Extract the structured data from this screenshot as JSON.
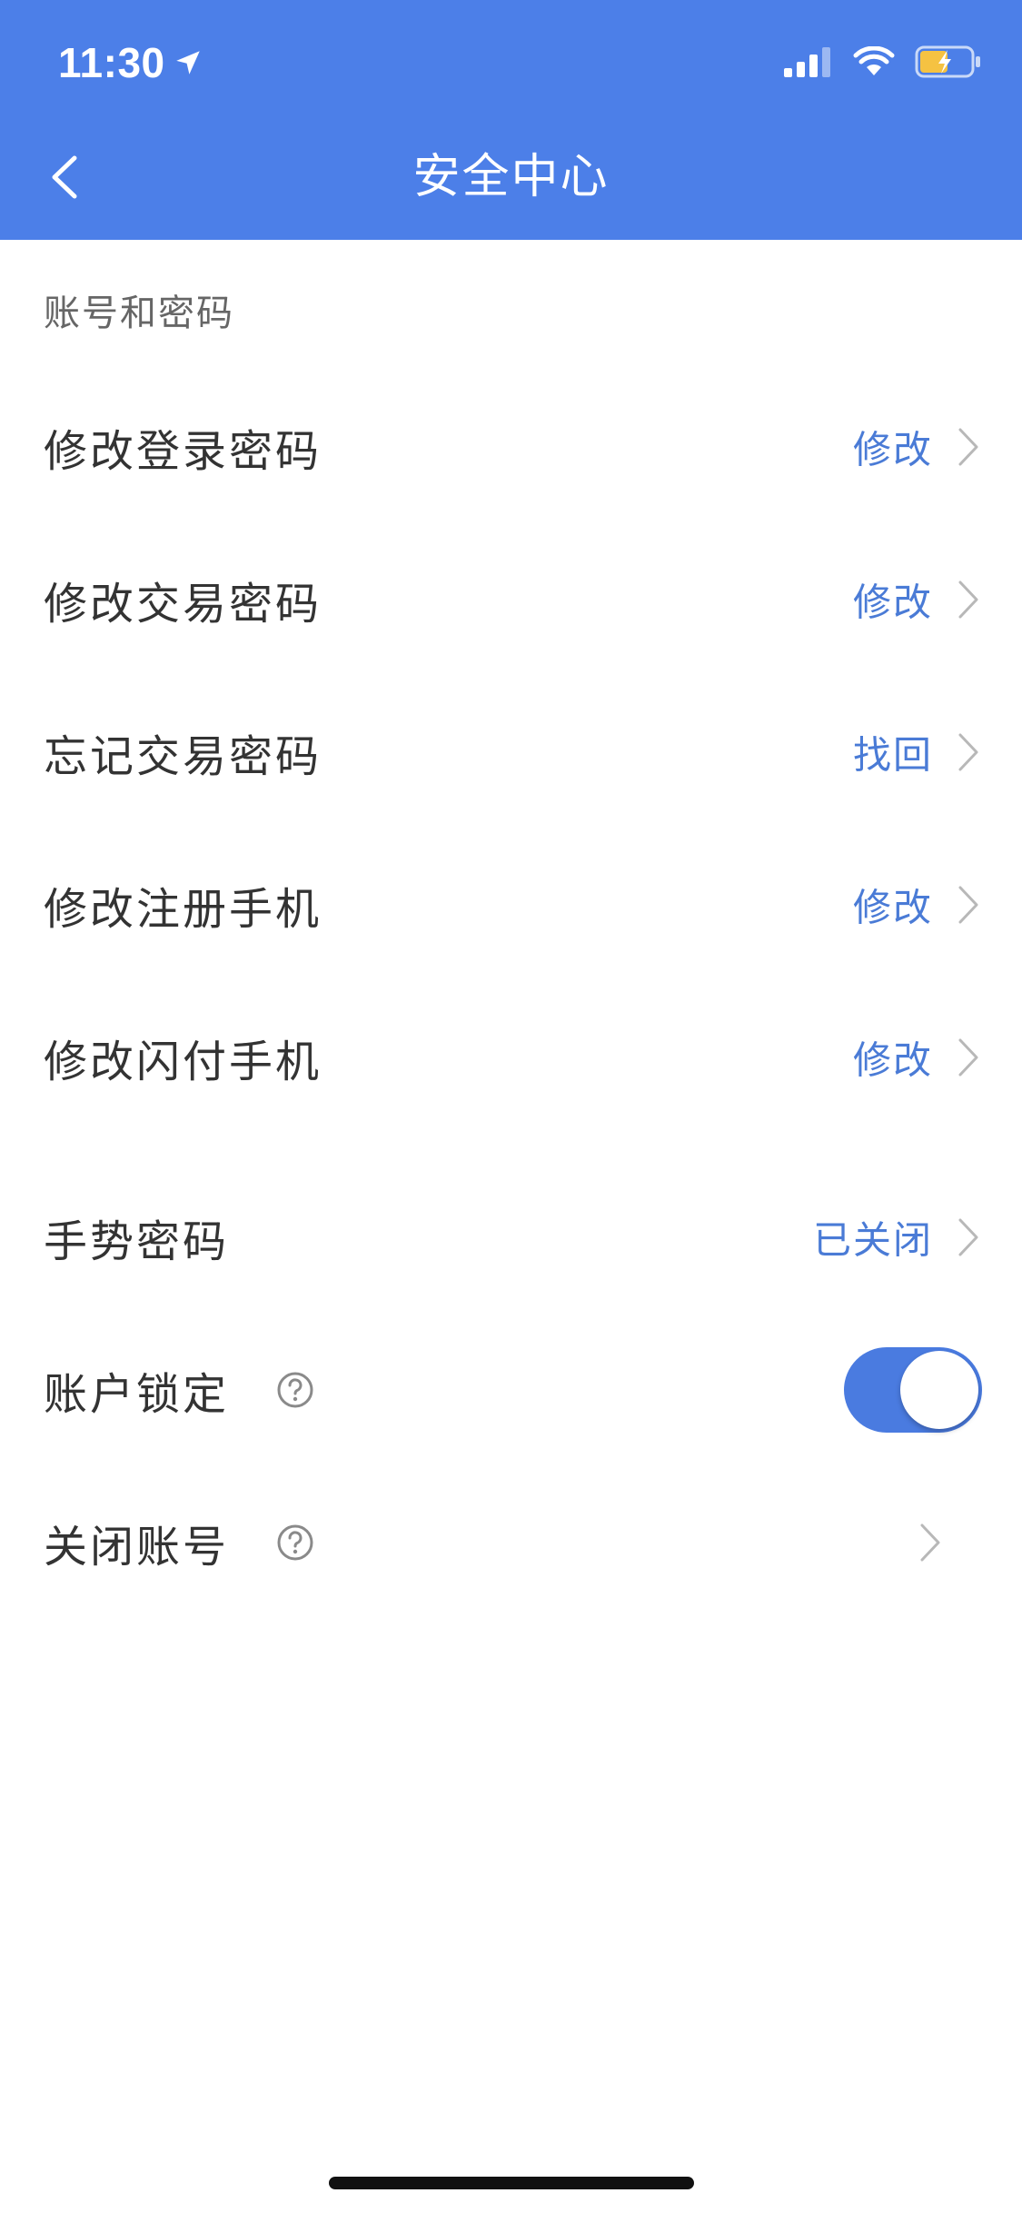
{
  "status_bar": {
    "time": "11:30",
    "icons": [
      "location-arrow-icon",
      "signal-icon",
      "wifi-icon",
      "battery-charging-icon"
    ]
  },
  "nav": {
    "back_icon": "chevron-left-icon",
    "title": "安全中心"
  },
  "section": {
    "title": "账号和密码"
  },
  "rows": [
    {
      "label": "修改登录密码",
      "action": "修改"
    },
    {
      "label": "修改交易密码",
      "action": "修改"
    },
    {
      "label": "忘记交易密码",
      "action": "找回"
    },
    {
      "label": "修改注册手机",
      "action": "修改"
    },
    {
      "label": "修改闪付手机",
      "action": "修改"
    }
  ],
  "gesture": {
    "label": "手势密码",
    "action": "已关闭"
  },
  "account_lock": {
    "label": "账户锁定",
    "toggle_on": true
  },
  "close_account": {
    "label": "关闭账号"
  },
  "colors": {
    "header": "#4c7fe8",
    "accent": "#4a7bd6",
    "label": "#333333",
    "section": "#666666"
  }
}
